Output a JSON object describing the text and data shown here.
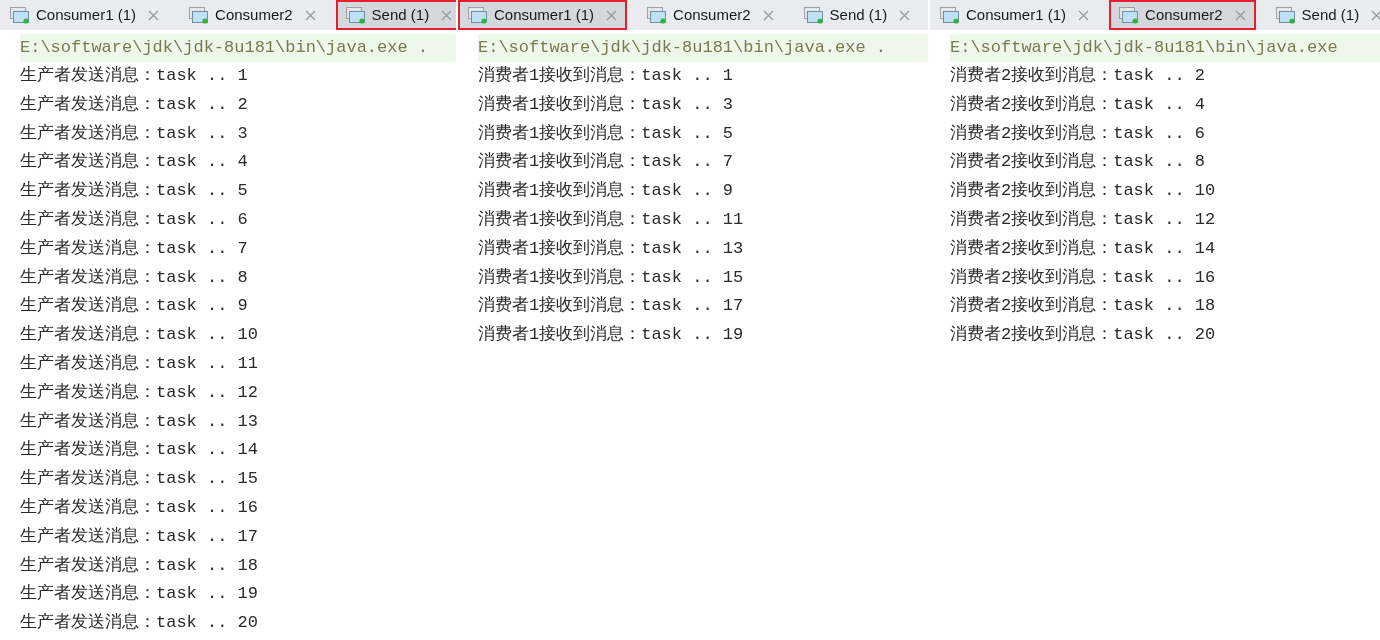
{
  "panels": [
    {
      "tabs": [
        {
          "label": "Consumer1 (1)",
          "selected": false
        },
        {
          "label": "Consumer2",
          "selected": false
        },
        {
          "label": "Send (1)",
          "selected": true
        }
      ],
      "header": "E:\\software\\jdk\\jdk-8u181\\bin\\java.exe .",
      "lines": [
        "生产者发送消息：task .. 1",
        "生产者发送消息：task .. 2",
        "生产者发送消息：task .. 3",
        "生产者发送消息：task .. 4",
        "生产者发送消息：task .. 5",
        "生产者发送消息：task .. 6",
        "生产者发送消息：task .. 7",
        "生产者发送消息：task .. 8",
        "生产者发送消息：task .. 9",
        "生产者发送消息：task .. 10",
        "生产者发送消息：task .. 11",
        "生产者发送消息：task .. 12",
        "生产者发送消息：task .. 13",
        "生产者发送消息：task .. 14",
        "生产者发送消息：task .. 15",
        "生产者发送消息：task .. 16",
        "生产者发送消息：task .. 17",
        "生产者发送消息：task .. 18",
        "生产者发送消息：task .. 19",
        "生产者发送消息：task .. 20"
      ]
    },
    {
      "tabs": [
        {
          "label": "Consumer1 (1)",
          "selected": true
        },
        {
          "label": "Consumer2",
          "selected": false
        },
        {
          "label": "Send (1)",
          "selected": false
        }
      ],
      "header": "E:\\software\\jdk\\jdk-8u181\\bin\\java.exe .",
      "lines": [
        "消费者1接收到消息：task .. 1",
        "消费者1接收到消息：task .. 3",
        "消费者1接收到消息：task .. 5",
        "消费者1接收到消息：task .. 7",
        "消费者1接收到消息：task .. 9",
        "消费者1接收到消息：task .. 11",
        "消费者1接收到消息：task .. 13",
        "消费者1接收到消息：task .. 15",
        "消费者1接收到消息：task .. 17",
        "消费者1接收到消息：task .. 19"
      ]
    },
    {
      "tabs": [
        {
          "label": "Consumer1 (1)",
          "selected": false
        },
        {
          "label": "Consumer2",
          "selected": true
        },
        {
          "label": "Send (1)",
          "selected": false
        }
      ],
      "header": "E:\\software\\jdk\\jdk-8u181\\bin\\java.exe",
      "lines": [
        "消费者2接收到消息：task .. 2",
        "消费者2接收到消息：task .. 4",
        "消费者2接收到消息：task .. 6",
        "消费者2接收到消息：task .. 8",
        "消费者2接收到消息：task .. 10",
        "消费者2接收到消息：task .. 12",
        "消费者2接收到消息：task .. 14",
        "消费者2接收到消息：task .. 16",
        "消费者2接收到消息：task .. 18",
        "消费者2接收到消息：task .. 20"
      ]
    }
  ]
}
